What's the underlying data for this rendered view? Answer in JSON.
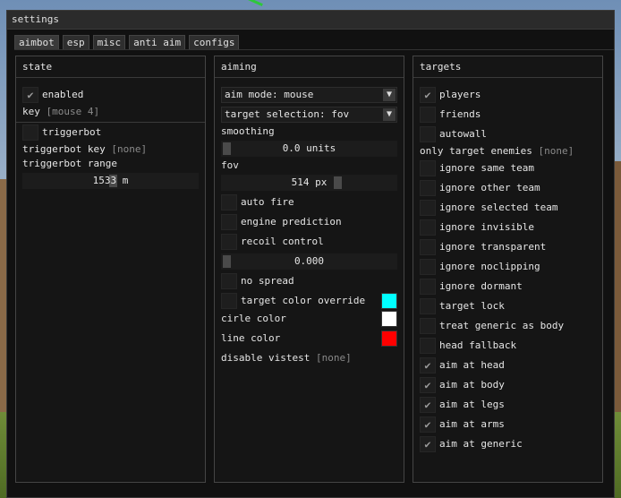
{
  "window_title": "settings",
  "tabs": [
    "aimbot",
    "esp",
    "misc",
    "anti aim",
    "configs"
  ],
  "state": {
    "title": "state",
    "enabled_label": "enabled",
    "key_label": "key",
    "key_value": "[mouse 4]",
    "triggerbot_label": "triggerbot",
    "triggerbot_key_label": "triggerbot key",
    "triggerbot_key_value": "[none]",
    "triggerbot_range_label": "triggerbot range",
    "triggerbot_range_value": "1533 m"
  },
  "aiming": {
    "title": "aiming",
    "aim_mode": "aim mode: mouse",
    "target_selection": "target selection: fov",
    "smoothing_label": "smoothing",
    "smoothing_value": "0.0 units",
    "fov_label": "fov",
    "fov_value": "514 px",
    "auto_fire": "auto fire",
    "engine_prediction": "engine prediction",
    "recoil_control": "recoil control",
    "recoil_value": "0.000",
    "no_spread": "no spread",
    "target_color_override": "target color override",
    "circle_color_label": "cirle color",
    "line_color_label": "line color",
    "disable_vistest_label": "disable vistest",
    "disable_vistest_value": "[none]",
    "colors": {
      "target": "#00ffff",
      "circle": "#ffffff",
      "line": "#ff0000"
    }
  },
  "targets": {
    "title": "targets",
    "players": "players",
    "friends": "friends",
    "autowall": "autowall",
    "only_enemies_label": "only target enemies",
    "only_enemies_value": "[none]",
    "items": [
      {
        "label": "ignore same team",
        "checked": false
      },
      {
        "label": "ignore other team",
        "checked": false
      },
      {
        "label": "ignore selected team",
        "checked": false
      },
      {
        "label": "ignore invisible",
        "checked": false
      },
      {
        "label": "ignore transparent",
        "checked": false
      },
      {
        "label": "ignore noclipping",
        "checked": false
      },
      {
        "label": "ignore dormant",
        "checked": false
      },
      {
        "label": "target lock",
        "checked": false
      },
      {
        "label": "treat generic as body",
        "checked": false
      },
      {
        "label": "head fallback",
        "checked": false
      },
      {
        "label": "aim at head",
        "checked": true
      },
      {
        "label": "aim at body",
        "checked": true
      },
      {
        "label": "aim at legs",
        "checked": true
      },
      {
        "label": "aim at arms",
        "checked": true
      },
      {
        "label": "aim at generic",
        "checked": true
      }
    ]
  },
  "icons": {
    "check": "checkmark-icon",
    "dropdown": "dropdown-arrow-icon"
  }
}
